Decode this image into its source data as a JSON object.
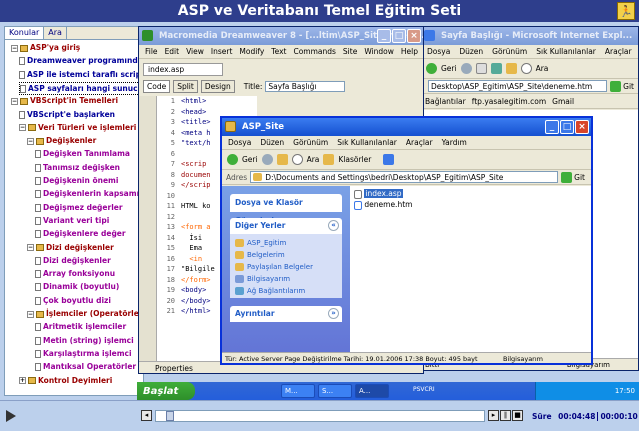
{
  "title": "ASP ve Veritabanı Temel Eğitim Seti",
  "exit_icon": "exit-icon",
  "toc": {
    "tabs": [
      "Konular",
      "Ara"
    ],
    "items": [
      {
        "text": "ASP'ya giriş",
        "indent": 0,
        "kind": "book",
        "exp": "−",
        "color": "red"
      },
      {
        "text": "Dreamweaver programında çalışma",
        "indent": 1,
        "kind": "page",
        "color": "blue"
      },
      {
        "text": "ASP ile istemci taraflı scriptler",
        "indent": 1,
        "kind": "page",
        "color": "blue"
      },
      {
        "text": "ASP sayfaları hangi sunucuda",
        "indent": 1,
        "kind": "page",
        "color": "blue",
        "selected": true
      },
      {
        "text": "VBScript'in Temelleri",
        "indent": 0,
        "kind": "book",
        "exp": "−",
        "color": "red"
      },
      {
        "text": "VBScript'e başlarken",
        "indent": 1,
        "kind": "page",
        "color": "blue"
      },
      {
        "text": "Veri Türleri ve işlemleri",
        "indent": 1,
        "kind": "book",
        "exp": "−",
        "color": "red"
      },
      {
        "text": "Değişkenler",
        "indent": 2,
        "kind": "book",
        "exp": "−",
        "color": "red"
      },
      {
        "text": "Değişken Tanımlama",
        "indent": 3,
        "kind": "page",
        "color": "pur"
      },
      {
        "text": "Tanımsız değişken",
        "indent": 3,
        "kind": "page",
        "color": "pur"
      },
      {
        "text": "Değişkenin önemi",
        "indent": 3,
        "kind": "page",
        "color": "pur"
      },
      {
        "text": "Değişkenlerin kapsamı",
        "indent": 3,
        "kind": "page",
        "color": "pur"
      },
      {
        "text": "Değişmez değerler",
        "indent": 3,
        "kind": "page",
        "color": "pur"
      },
      {
        "text": "Variant veri tipi",
        "indent": 3,
        "kind": "page",
        "color": "pur"
      },
      {
        "text": "Değişkenlere değer",
        "indent": 3,
        "kind": "page",
        "color": "pur"
      },
      {
        "text": "Dizi değişkenler",
        "indent": 2,
        "kind": "book",
        "exp": "−",
        "color": "red"
      },
      {
        "text": "Dizi değişkenler",
        "indent": 3,
        "kind": "page",
        "color": "pur"
      },
      {
        "text": "Array fonksiyonu",
        "indent": 3,
        "kind": "page",
        "color": "pur"
      },
      {
        "text": "Dinamik (boyutlu)",
        "indent": 3,
        "kind": "page",
        "color": "pur"
      },
      {
        "text": "Çok boyutlu dizi",
        "indent": 3,
        "kind": "page",
        "color": "pur"
      },
      {
        "text": "İşlemciler (Operatörler)",
        "indent": 2,
        "kind": "book",
        "exp": "−",
        "color": "red"
      },
      {
        "text": "Aritmetik işlemciler",
        "indent": 3,
        "kind": "page",
        "color": "pur"
      },
      {
        "text": "Metin (string) işlemci",
        "indent": 3,
        "kind": "page",
        "color": "pur"
      },
      {
        "text": "Karşılaştırma işlemci",
        "indent": 3,
        "kind": "page",
        "color": "pur"
      },
      {
        "text": "Mantıksal Operatörler",
        "indent": 3,
        "kind": "page",
        "color": "pur"
      },
      {
        "text": "Kontrol Deyimleri",
        "indent": 1,
        "kind": "book",
        "exp": "+",
        "color": "red"
      }
    ]
  },
  "dw": {
    "title": "Macromedia Dreamweaver 8 - [...ltim\\ASP_Site\\index.a...",
    "menu": [
      "File",
      "Edit",
      "View",
      "Insert",
      "Modify",
      "Text",
      "Commands",
      "Site",
      "Window",
      "Help"
    ],
    "doc_tab": "index.asp",
    "views": [
      "Code",
      "Split",
      "Design"
    ],
    "title_label": "Title:",
    "title_value": "Sayfa Başlığı",
    "line_numbers": [
      "1",
      "2",
      "3",
      "4",
      "5",
      "6",
      "7",
      "8",
      "9",
      "10",
      "11",
      "12",
      "13",
      "14",
      "15",
      "16",
      "17",
      "18",
      "19",
      "20",
      "21"
    ],
    "code_lines": [
      {
        "text": "",
        "color": "#000"
      },
      {
        "text": "<html>",
        "color": "#000080"
      },
      {
        "text": "<head>",
        "color": "#000080"
      },
      {
        "text": "<title>",
        "color": "#000080"
      },
      {
        "text": "<meta h",
        "color": "#000080"
      },
      {
        "text": "\"text/h",
        "color": "#000080"
      },
      {
        "text": "",
        "color": "#000"
      },
      {
        "text": "<scrip",
        "color": "#990000"
      },
      {
        "text": "documen",
        "color": "#990000"
      },
      {
        "text": "</scrip",
        "color": "#990000"
      },
      {
        "text": "",
        "color": "#000"
      },
      {
        "text": "HTML ko",
        "color": "#000"
      },
      {
        "text": "",
        "color": "#000"
      },
      {
        "text": "<form a",
        "color": "#ff6600"
      },
      {
        "text": "  İsi",
        "color": "#000"
      },
      {
        "text": "  Ema",
        "color": "#000"
      },
      {
        "text": "  <in",
        "color": "#ff6600"
      },
      {
        "text": "\"Bilgile",
        "color": "#000"
      },
      {
        "text": "</form>",
        "color": "#ff6600"
      },
      {
        "text": "<body>",
        "color": "#000080"
      },
      {
        "text": "</body>",
        "color": "#000080"
      },
      {
        "text": "</html>",
        "color": "#000080"
      }
    ],
    "properties": "Properties"
  },
  "ie": {
    "title": "Sayfa Başlığı - Microsoft Internet Expl...",
    "menu": [
      "Dosya",
      "Düzen",
      "Görünüm",
      "Sık Kullanılanlar",
      "Araçlar"
    ],
    "back": "Geri",
    "search": "Ara",
    "address": "Desktop\\ASP_Egitim\\ASP_Site\\deneme.htm",
    "go": "Git",
    "links": [
      "Bağlantılar",
      "ftp.yasalegitim.com",
      "Gmail"
    ],
    "status": "Bitti",
    "zone": "Bilgisayarım"
  },
  "exp": {
    "title": "ASP_Site",
    "menu": [
      "Dosya",
      "Düzen",
      "Görünüm",
      "Sık Kullanılanlar",
      "Araçlar",
      "Yardım"
    ],
    "back": "Geri",
    "search": "Ara",
    "folders": "Klasörler",
    "address_label": "Adres",
    "address": "D:\\Documents and Settings\\bedri\\Desktop\\ASP_Egitim\\ASP_Site",
    "go": "Git",
    "task1": "Dosya ve Klasör Görevleri",
    "task2": "Diğer Yerler",
    "places": [
      "ASP_Egitim",
      "Belgelerim",
      "Paylaşılan Belgeler",
      "Bilgisayarım",
      "Ağ Bağlantılarım"
    ],
    "task3": "Ayrıntılar",
    "files": [
      "index.asp",
      "deneme.htm"
    ],
    "status": "Tür: Active Server Page Değiştirilme Tarihi: 19.01.2006 17:38 Boyut: 495 bayt",
    "status_size": "495 bayt",
    "status_zone": "Bilgisayarım"
  },
  "taskbar": {
    "start": "Başlat",
    "buttons": [
      "M...",
      "S...",
      "A...",
      "PSVCRI"
    ],
    "clock": "17:50"
  },
  "player": {
    "time_label": "Süre",
    "elapsed": "00:04:48",
    "total": "00:00:10",
    "progress": 0.03
  }
}
